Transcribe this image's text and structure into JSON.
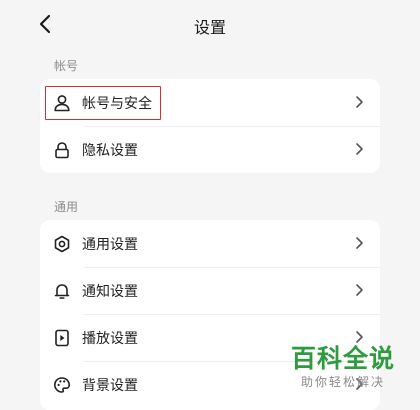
{
  "header": {
    "title": "设置",
    "back_icon": "chevron-left-icon"
  },
  "sections": [
    {
      "label": "帐号",
      "items": [
        {
          "label": "帐号与安全",
          "icon": "user-icon",
          "highlighted": true
        },
        {
          "label": "隐私设置",
          "icon": "lock-icon"
        }
      ]
    },
    {
      "label": "通用",
      "items": [
        {
          "label": "通用设置",
          "icon": "gear-icon"
        },
        {
          "label": "通知设置",
          "icon": "bell-icon"
        },
        {
          "label": "播放设置",
          "icon": "play-icon"
        },
        {
          "label": "背景设置",
          "icon": "palette-icon"
        }
      ]
    }
  ],
  "colors": {
    "background": "#f5f5f5",
    "card": "#ffffff",
    "highlight_border": "#d32f2f",
    "watermark_green": "#2e9b3f"
  },
  "watermark": {
    "main": "百科全说",
    "sub": "助你轻松解决"
  }
}
